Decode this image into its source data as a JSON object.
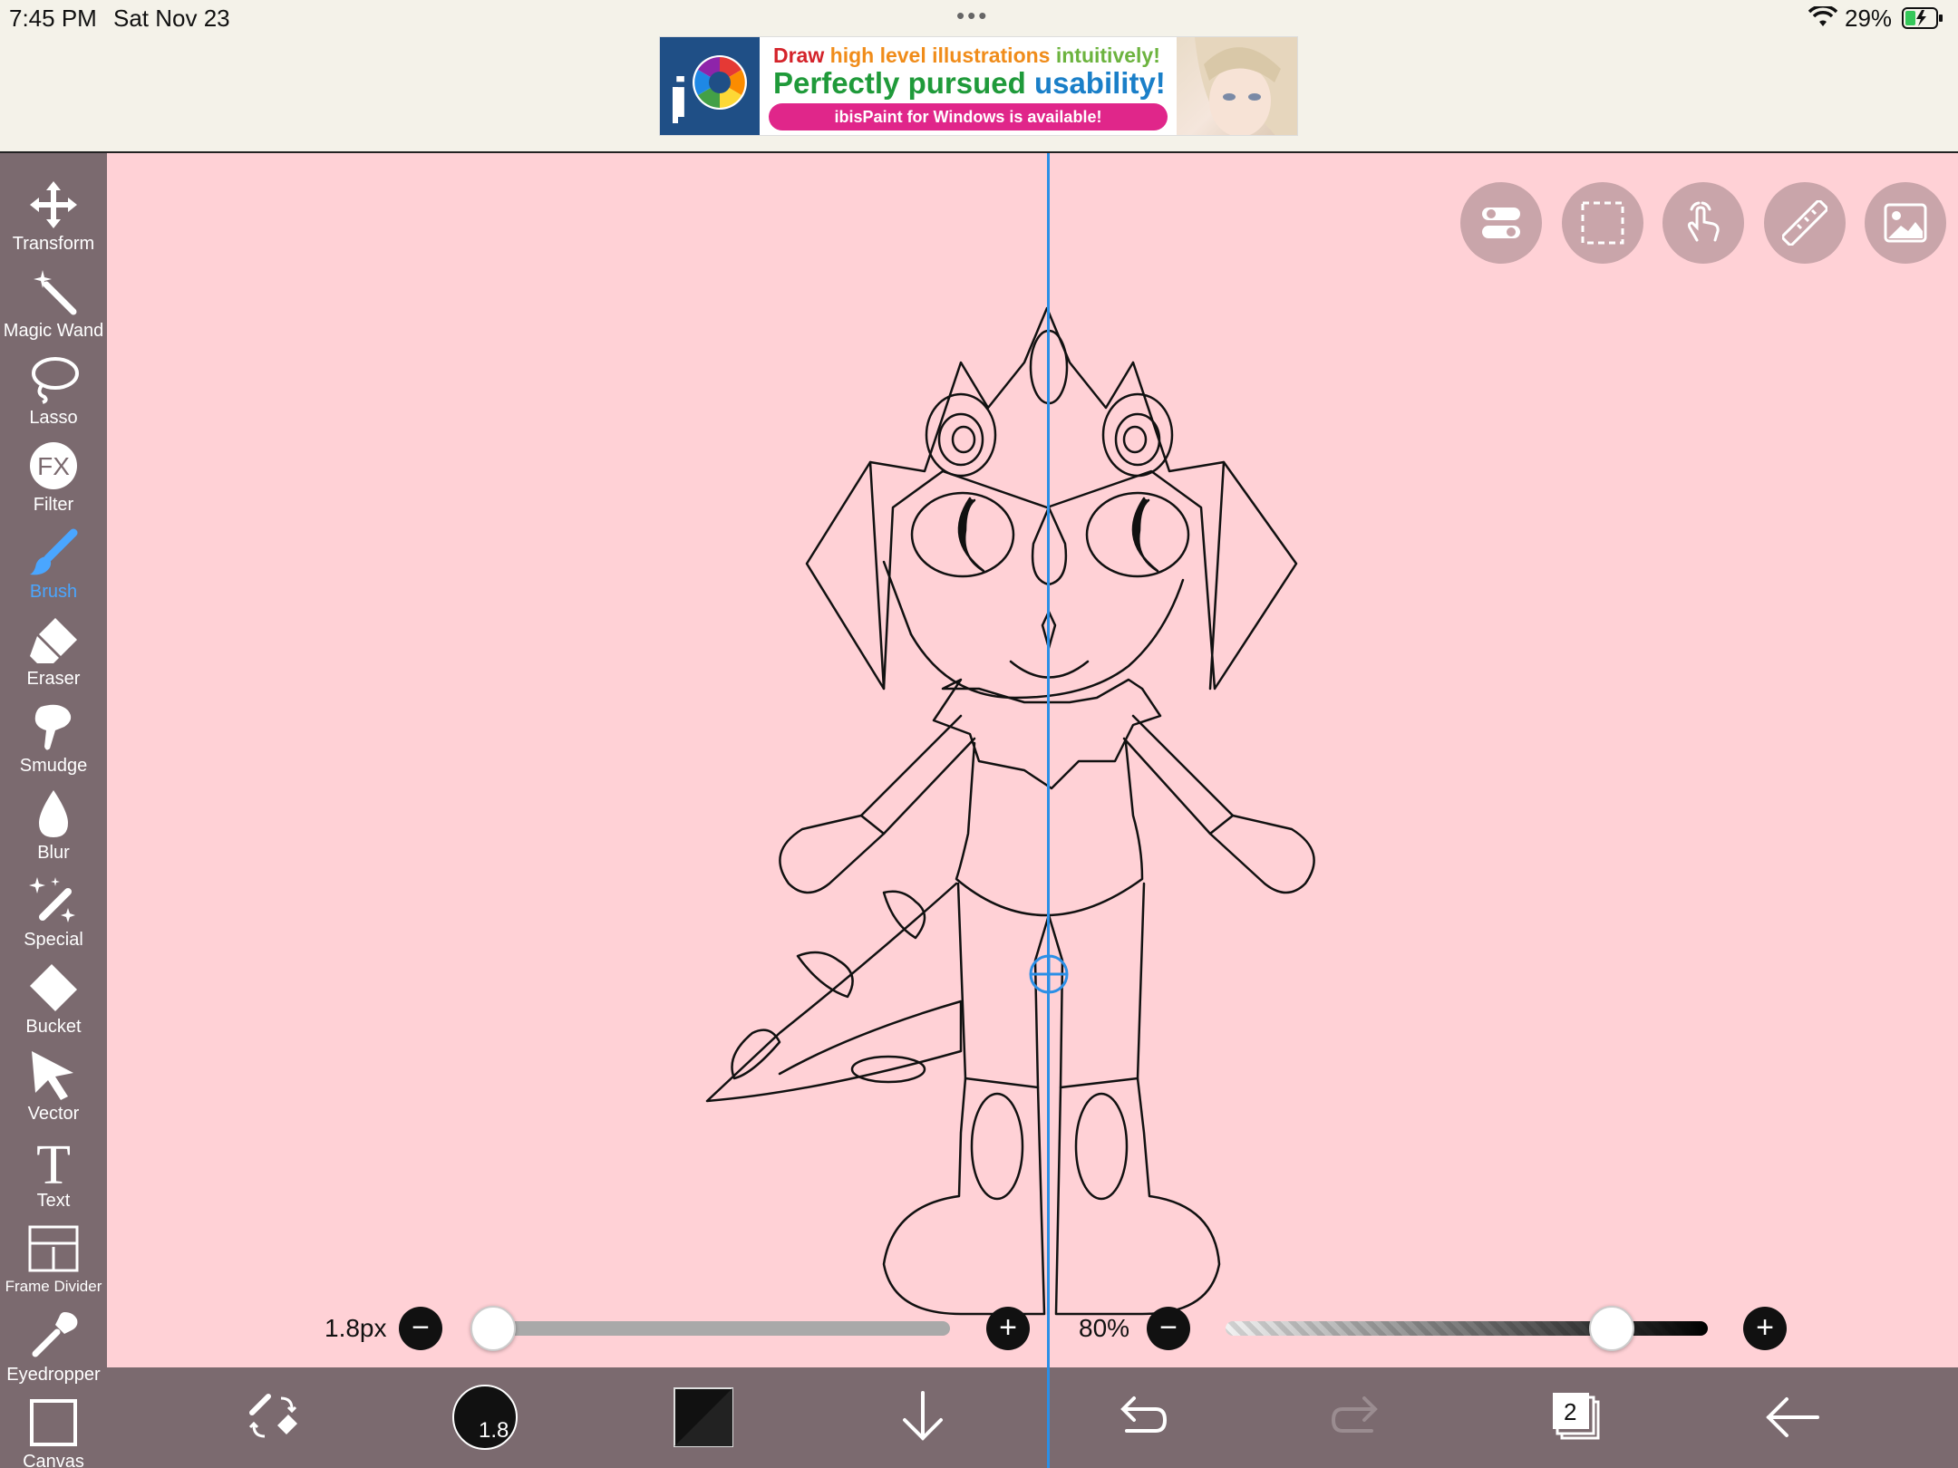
{
  "status_bar": {
    "time": "7:45 PM",
    "date": "Sat Nov 23",
    "dots": "•••",
    "battery_pct": "29%"
  },
  "ad": {
    "line1_words": [
      "Draw",
      "high level illustrations",
      "intuitively!"
    ],
    "line2_words": [
      "Perfectly pursued",
      "usability!"
    ],
    "pill_text": "ibisPaint for Windows is available!"
  },
  "toolbar": {
    "tools": [
      {
        "label": "Transform",
        "icon": "move-arrows-icon"
      },
      {
        "label": "Magic Wand",
        "icon": "magic-wand-icon"
      },
      {
        "label": "Lasso",
        "icon": "lasso-icon"
      },
      {
        "label": "Filter",
        "icon": "fx-filter-icon"
      },
      {
        "label": "Brush",
        "icon": "brush-icon",
        "active": true
      },
      {
        "label": "Eraser",
        "icon": "eraser-icon"
      },
      {
        "label": "Smudge",
        "icon": "smudge-icon"
      },
      {
        "label": "Blur",
        "icon": "blur-drop-icon"
      },
      {
        "label": "Special",
        "icon": "special-sparkle-icon"
      },
      {
        "label": "Bucket",
        "icon": "bucket-icon"
      },
      {
        "label": "Vector",
        "icon": "vector-arrow-icon"
      },
      {
        "label": "Text",
        "icon": "text-t-icon"
      },
      {
        "label": "Frame Divider",
        "icon": "frame-divider-icon"
      },
      {
        "label": "Eyedropper",
        "icon": "eyedropper-icon"
      },
      {
        "label": "Canvas",
        "icon": "canvas-icon"
      }
    ]
  },
  "canvas_buttons": [
    "toggle-settings-icon",
    "selection-icon",
    "touch-gesture-icon",
    "ruler-icon",
    "reference-image-icon"
  ],
  "brush": {
    "size_label": "1.8px",
    "size_value": 1.8,
    "opacity_label": "80%",
    "opacity_value": 0.8
  },
  "bottom_bar": {
    "brush_size_badge": "1.8",
    "layer_count": "2"
  },
  "colors": {
    "canvas_bg": "#ffd1d6",
    "toolbar_bg": "#7b6a6f",
    "accent": "#4aa6ff",
    "guide": "#2b8fe6"
  }
}
